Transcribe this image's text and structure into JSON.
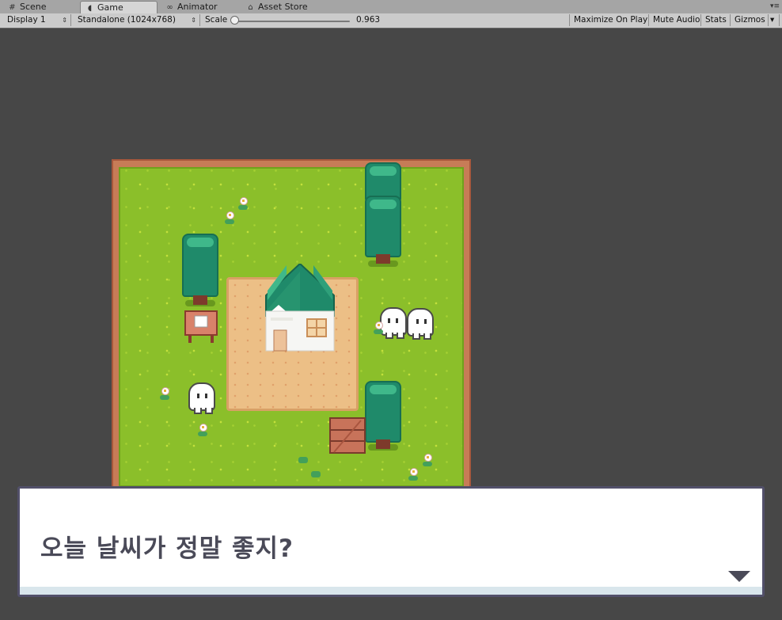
{
  "tabs": [
    {
      "label": "Scene",
      "icon": "grid-icon",
      "active": false
    },
    {
      "label": "Game",
      "icon": "pacman-icon",
      "active": true
    },
    {
      "label": "Animator",
      "icon": "animator-icon",
      "active": false
    },
    {
      "label": "Asset Store",
      "icon": "store-icon",
      "active": false
    }
  ],
  "toolbar": {
    "display_select": "Display 1",
    "resolution_select": "Standalone (1024x768)",
    "scale_label": "Scale",
    "scale_value": "0.963",
    "maximize_label": "Maximize On Play",
    "mute_label": "Mute Audio",
    "stats_label": "Stats",
    "gizmos_label": "Gizmos"
  },
  "dialog": {
    "text": "오늘 날씨가 정말 좋지?",
    "icon": "continue-arrow-icon"
  },
  "colors": {
    "grass": "#8bbf2a",
    "sand": "#ecbf86",
    "dialog_text": "#4a4a58"
  }
}
